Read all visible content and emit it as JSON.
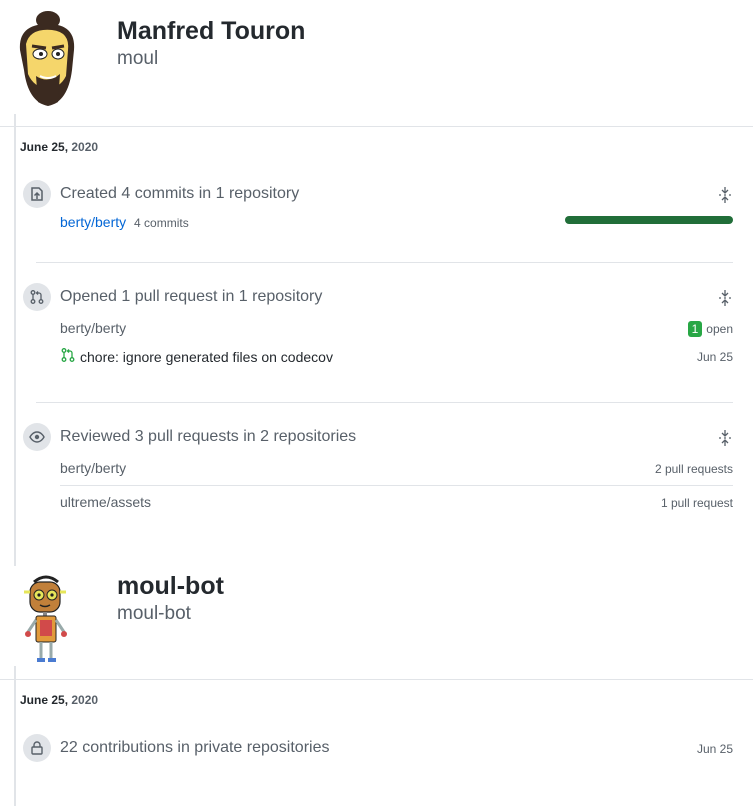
{
  "profiles": [
    {
      "name": "Manfred Touron",
      "login": "moul",
      "date_month_day": "June 25,",
      "date_year": "2020",
      "activities": [
        {
          "icon": "repo-push-icon",
          "title": "Created 4 commits in 1 repository",
          "repo": "berty/berty",
          "repo_meta": "4 commits",
          "commit_fraction": 1.0
        },
        {
          "icon": "pull-request-icon",
          "title": "Opened 1 pull request in 1 repository",
          "repo": "berty/berty",
          "open_count": "1",
          "open_label": "open",
          "pr_title": "chore: ignore generated files on codecov",
          "pr_date": "Jun 25"
        },
        {
          "icon": "eye-icon",
          "title": "Reviewed 3 pull requests in 2 repositories",
          "repos": [
            {
              "name": "berty/berty",
              "count": "2 pull requests"
            },
            {
              "name": "ultreme/assets",
              "count": "1 pull request"
            }
          ]
        }
      ]
    },
    {
      "name": "moul-bot",
      "login": "moul-bot",
      "date_month_day": "June 25,",
      "date_year": "2020",
      "activities": [
        {
          "icon": "lock-icon",
          "title": "22 contributions in private repositories",
          "date": "Jun 25"
        }
      ]
    }
  ],
  "colors": {
    "link": "#0366d6",
    "commit_bar": "#216e39",
    "open_badge": "#28a745",
    "muted": "#586069"
  }
}
